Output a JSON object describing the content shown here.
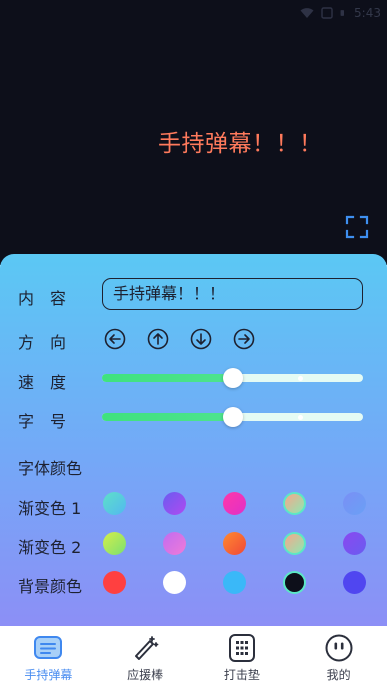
{
  "status_bar": {
    "time": "5:43"
  },
  "preview": {
    "barrage_text": "手持弹幕！！！"
  },
  "settings": {
    "content": {
      "label": "内　容",
      "value": "手持弹幕！！！"
    },
    "direction": {
      "label": "方　向",
      "options": [
        "left-arrow-icon",
        "up-arrow-icon",
        "down-arrow-icon",
        "right-arrow-icon"
      ]
    },
    "speed": {
      "label": "速　度",
      "value": 0.5
    },
    "font_size": {
      "label": "字　号",
      "value": 0.5
    },
    "font_color_title": "字体颜色",
    "gradient1": {
      "label": "渐变色 1",
      "colors": [
        [
          "#5ee0c8",
          "#52b8f0"
        ],
        [
          "#6a5cf0",
          "#b04af0"
        ],
        [
          "#ff38a8",
          "#e030c8"
        ],
        [
          "#f7a78c",
          "#8ee8b0"
        ],
        [
          "#7a8ff5",
          "#6aa0f5"
        ]
      ]
    },
    "gradient2": {
      "label": "渐变色 2",
      "colors": [
        [
          "#d5ee4a",
          "#7ae070"
        ],
        [
          "#c06cf0",
          "#f07ad8"
        ],
        [
          "#ff8a30",
          "#f04838"
        ],
        [
          "#f7a78c",
          "#8ee8b0"
        ],
        [
          "#8a48f0",
          "#6a5cf0"
        ]
      ]
    },
    "background": {
      "label": "背景颜色",
      "colors": [
        "#ff4040",
        "#ffffff",
        "#3ab8f8",
        "#0d0f1a",
        "#5046f0"
      ]
    }
  },
  "nav": [
    {
      "label": "手持弹幕",
      "icon": "barrage-icon",
      "active": true
    },
    {
      "label": "应援棒",
      "icon": "wand-icon",
      "active": false
    },
    {
      "label": "打击垫",
      "icon": "pad-icon",
      "active": false
    },
    {
      "label": "我的",
      "icon": "profile-icon",
      "active": false
    }
  ],
  "colors": {
    "accent": "#4a8df0",
    "barrage": "#ff7a5c",
    "preview_bg": "#0d0f1a"
  }
}
